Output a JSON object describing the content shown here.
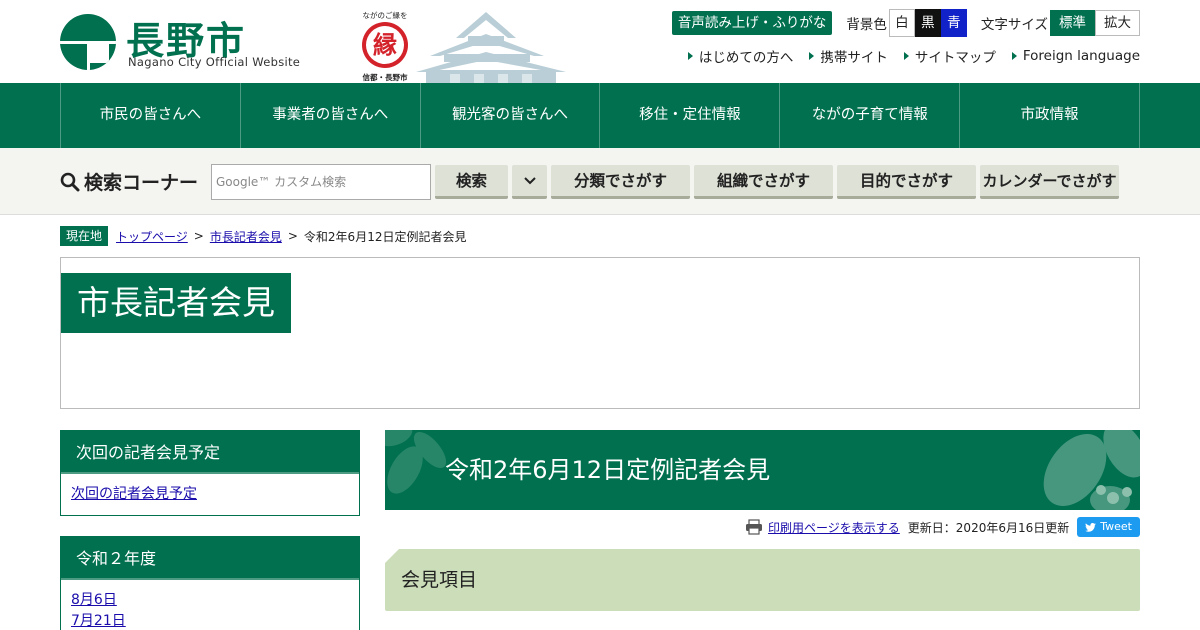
{
  "header": {
    "logo_title": "長野市",
    "logo_subtitle": "Nagano City Official Website",
    "mascot_top": "ながのご縁を",
    "mascot_char": "縁",
    "mascot_bottom": "信都・長野市",
    "voice_button": "音声読み上げ・ふりがな",
    "bg_color_label": "背景色",
    "bg_white": "白",
    "bg_black": "黒",
    "bg_blue": "青",
    "font_size_label": "文字サイズ",
    "font_standard": "標準",
    "font_large": "拡大",
    "links": [
      "はじめての方へ",
      "携帯サイト",
      "サイトマップ",
      "Foreign language"
    ],
    "colors": {
      "brand": "#00704f",
      "blue_bg": "#1022c8"
    }
  },
  "global_nav": [
    "市民の皆さんへ",
    "事業者の皆さんへ",
    "観光客の皆さんへ",
    "移住・定住情報",
    "ながの子育て情報",
    "市政情報"
  ],
  "search": {
    "label": "検索コーナー",
    "placeholder": "Google™ カスタム検索",
    "search_button": "検索",
    "buttons": [
      "分類でさがす",
      "組織でさがす",
      "目的でさがす",
      "カレンダーでさがす"
    ]
  },
  "breadcrumb": {
    "badge": "現在地",
    "top": "トップページ",
    "parent": "市長記者会見",
    "current": "令和2年6月12日定例記者会見",
    "sep": ">"
  },
  "page_title": "市長記者会見",
  "sidebar": {
    "next": {
      "heading": "次回の記者会見予定",
      "link": "次回の記者会見予定"
    },
    "year": {
      "heading": "令和２年度",
      "links": [
        "8月6日",
        "7月21日"
      ]
    }
  },
  "article": {
    "title": "令和2年6月12日定例記者会見",
    "print_link": "印刷用ページを表示する",
    "updated": "更新日：2020年6月16日更新",
    "tweet": "Tweet",
    "section_heading": "会見項目"
  }
}
